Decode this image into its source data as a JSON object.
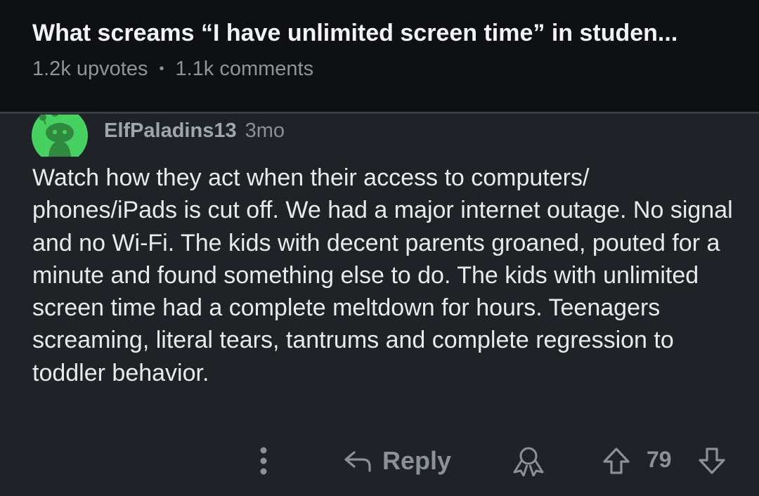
{
  "post": {
    "title": "What screams “I have unlimited screen time” in studen...",
    "upvotes": "1.2k upvotes",
    "separator": "•",
    "comments": "1.1k comments"
  },
  "comment": {
    "author": "ElfPaladins13",
    "age": "3mo",
    "body": "Watch how they act when their access to computers/ phones/iPads is cut off. We had a major internet outage. No signal and no Wi-Fi. The kids with decent parents groaned, pouted for a minute and found something else to do. The kids with unlimited screen time had a complete meltdown for hours. Teenagers screaming, literal tears, tantrums and complete regression to toddler behavior.",
    "actions": {
      "reply_label": "Reply",
      "score": "79"
    }
  },
  "icons": {
    "more": "more-vertical-icon",
    "reply": "reply-arrow-icon",
    "award": "award-icon",
    "upvote": "upvote-arrow-icon",
    "downvote": "downvote-arrow-icon",
    "avatar": "snoo-avatar-icon"
  },
  "colors": {
    "header_bg": "#0f1012",
    "comment_bg": "#1f2227",
    "avatar_green": "#46d160",
    "text_primary": "#e8eaed",
    "text_muted": "#8a9198"
  }
}
